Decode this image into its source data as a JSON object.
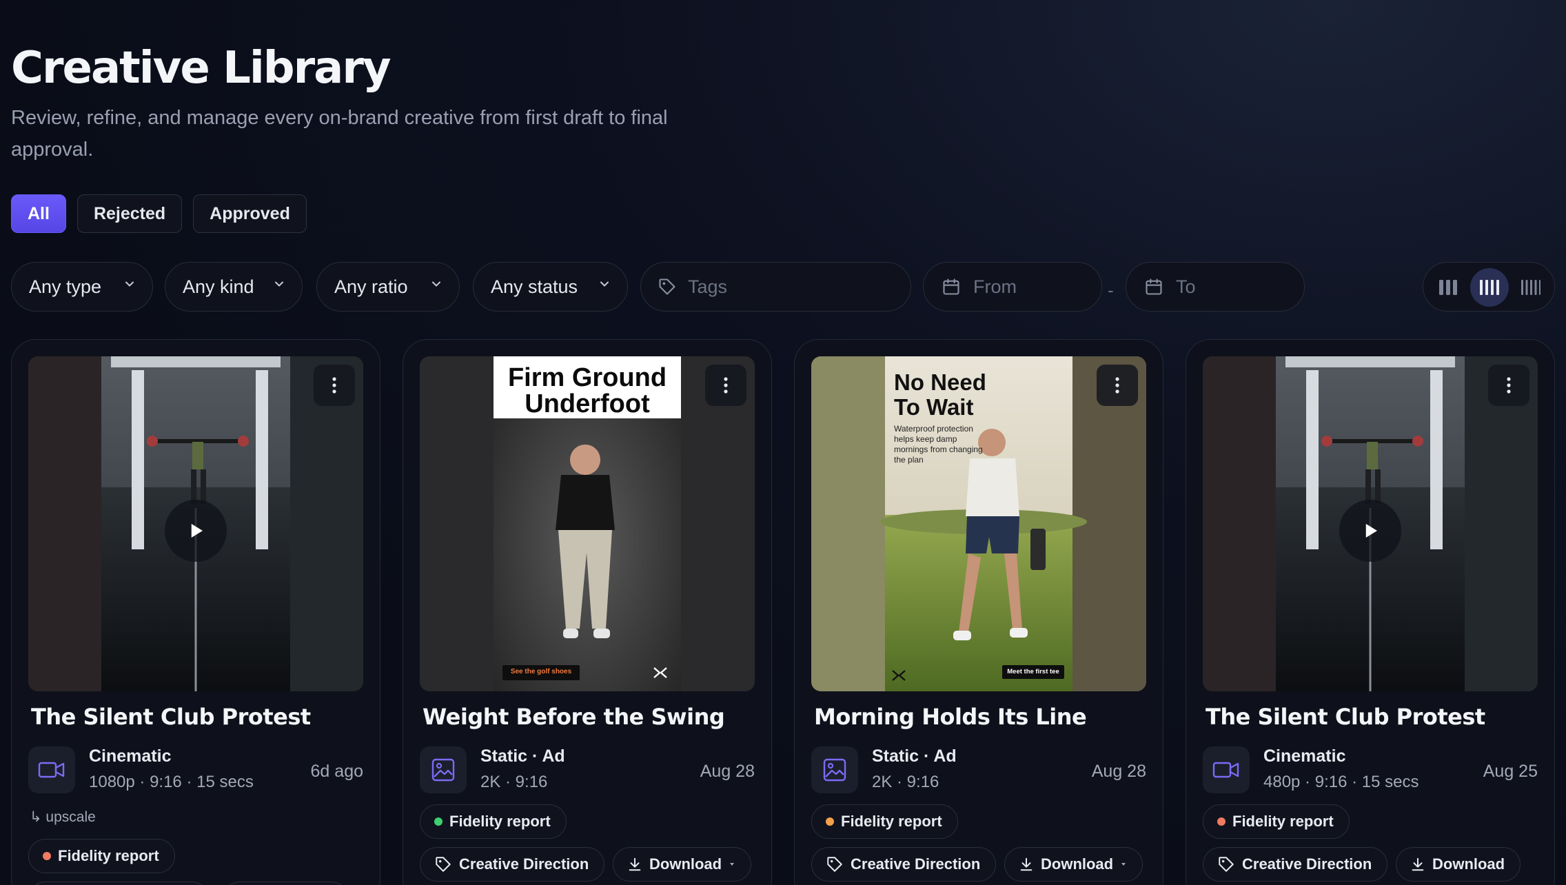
{
  "header": {
    "title": "Creative Library",
    "subtitle": "Review, refine, and manage every on-brand creative from first draft to final approval."
  },
  "tabs": [
    {
      "label": "All",
      "active": true
    },
    {
      "label": "Rejected",
      "active": false
    },
    {
      "label": "Approved",
      "active": false
    }
  ],
  "filters": {
    "type": "Any type",
    "kind": "Any kind",
    "ratio": "Any ratio",
    "status": "Any status",
    "tags_placeholder": "Tags",
    "from_placeholder": "From",
    "to_placeholder": "To",
    "range_separator": "-"
  },
  "view_toggle": {
    "selected": "4 columns",
    "options": [
      "3 columns",
      "4 columns",
      "5 columns"
    ]
  },
  "cards": [
    {
      "title": "The Silent Club Protest",
      "media_type": "video",
      "kind": "Cinematic",
      "specs": "1080p · 9:16 · 15 secs",
      "date": "6d ago",
      "lineage": "↳ upscale",
      "fidelity_label": "Fidelity report",
      "fidelity_status_color": "#f07a62"
    },
    {
      "title": "Weight Before the Swing",
      "media_type": "image",
      "kind": "Static · Ad",
      "specs": "2K · 9:16",
      "date": "Aug 28",
      "fidelity_label": "Fidelity report",
      "fidelity_status_color": "#3ecf6e",
      "direction_label": "Creative Direction",
      "download_label": "Download",
      "ad_headline": "Firm Ground Underfoot",
      "ad_cta": "See the golf shoes"
    },
    {
      "title": "Morning Holds Its Line",
      "media_type": "image",
      "kind": "Static · Ad",
      "specs": "2K · 9:16",
      "date": "Aug 28",
      "fidelity_label": "Fidelity report",
      "fidelity_status_color": "#f5a04a",
      "direction_label": "Creative Direction",
      "download_label": "Download",
      "ad_headline": "No Need To Wait",
      "ad_body": "Waterproof protection helps keep damp mornings from changing the plan",
      "ad_cta": "Meet the first tee"
    },
    {
      "title": "The Silent Club Protest",
      "media_type": "video",
      "kind": "Cinematic",
      "specs": "480p · 9:16 · 15 secs",
      "date": "Aug 25",
      "fidelity_label": "Fidelity report",
      "fidelity_status_color": "#f07a62",
      "direction_label": "Creative Direction",
      "download_label": "Download"
    }
  ]
}
